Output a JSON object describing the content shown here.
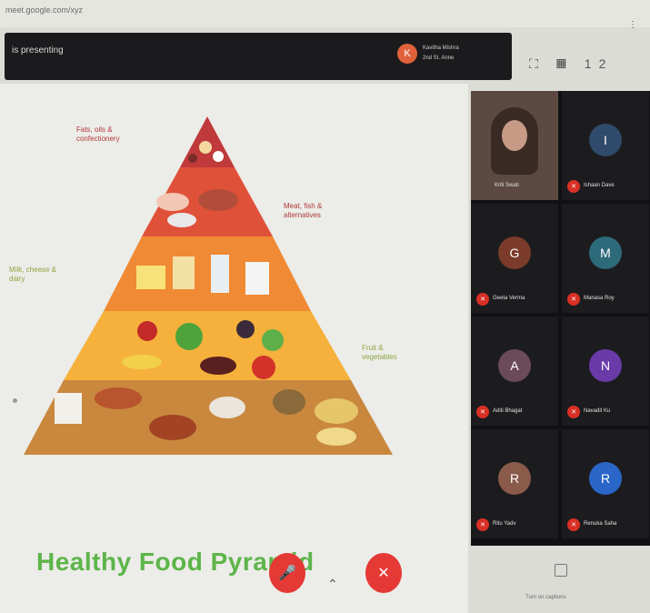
{
  "browser": {
    "url": "meet.google.com/xyz",
    "menu_dots": "⋮"
  },
  "topbar": {
    "present_label": "is presenting",
    "presenter_initial": "K",
    "presenter_name": "Kavitha Mishra",
    "presenter_sub": "2nd St. Anne"
  },
  "top_tools": "⛶ ▦ 12",
  "slide": {
    "title": "Healthy Food Pyramid",
    "labels": {
      "fats": [
        "Fats, oils &",
        "confectionery"
      ],
      "meat": [
        "Meat, fish &",
        "alternatives"
      ],
      "milk": [
        "Milk, cheese &",
        "dairy"
      ],
      "fruit": [
        "Fruit &",
        "vegetables"
      ]
    },
    "colors": {
      "tier1": "#c0393b",
      "tier2": "#e0513a",
      "tier3": "#f08a34",
      "tier4": "#f5b13c",
      "tier5": "#c9883e",
      "title": "#5db54a"
    }
  },
  "participants": [
    {
      "name": "Kriti Swati",
      "initial": "",
      "color": "",
      "camera": true
    },
    {
      "name": "Ishaan Dave",
      "initial": "I",
      "color": "#2f4a6a",
      "camera": false
    },
    {
      "name": "Geeta Verma",
      "initial": "G",
      "color": "#7a3b2a",
      "camera": false
    },
    {
      "name": "Manasa Roy",
      "initial": "M",
      "color": "#2d6a7a",
      "camera": false
    },
    {
      "name": "Aditi Bhagat",
      "initial": "A",
      "color": "#6b4a5a",
      "camera": false
    },
    {
      "name": "Navadit Ku",
      "initial": "N",
      "color": "#6a3aa8",
      "camera": false
    },
    {
      "name": "Ritu Yadv",
      "initial": "R",
      "color": "#8a5a4a",
      "camera": false
    },
    {
      "name": "Renuka Saha",
      "initial": "R",
      "color": "#2a66c8",
      "camera": false
    }
  ],
  "controls": {
    "mic_icon": "🎤",
    "cam_icon": "✕",
    "more": "⌃",
    "captions": "Turn on captions"
  }
}
